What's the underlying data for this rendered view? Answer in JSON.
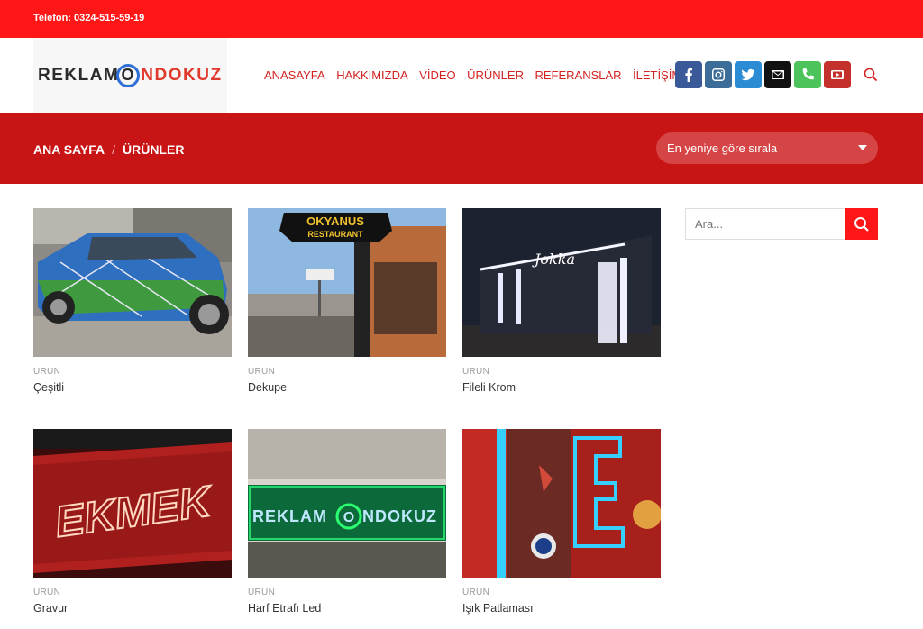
{
  "topbar": {
    "phone": "Telefon: 0324-515-59-19"
  },
  "header": {
    "logo": {
      "part1": "REKLAM",
      "ring": "O",
      "part2": "NDOKUZ"
    },
    "nav": [
      {
        "label": "ANASAYFA"
      },
      {
        "label": "HAKKIMIZDA"
      },
      {
        "label": "VİDEO"
      },
      {
        "label": "ÜRÜNLER"
      },
      {
        "label": "REFERANSLAR"
      },
      {
        "label": "İLETİŞİM"
      }
    ],
    "social": [
      {
        "icon": "facebook-icon",
        "color": "#3a5998"
      },
      {
        "icon": "instagram-icon",
        "color": "#3b6d98"
      },
      {
        "icon": "twitter-icon",
        "color": "#2b8bd4"
      },
      {
        "icon": "envelope-icon",
        "color": "#111111"
      },
      {
        "icon": "phone-icon",
        "color": "#4cc35b"
      },
      {
        "icon": "youtube-icon",
        "color": "#c4302b"
      }
    ]
  },
  "banner": {
    "breadcrumb": {
      "home": "ANA SAYFA",
      "separator": "/",
      "current": "ÜRÜNLER"
    },
    "sort": {
      "selected": "En yeniye göre sırala"
    }
  },
  "products": [
    {
      "category": "URUN",
      "name": "Çeşitli"
    },
    {
      "category": "URUN",
      "name": "Dekupe"
    },
    {
      "category": "URUN",
      "name": "Fileli Krom"
    },
    {
      "category": "URUN",
      "name": "Gravur"
    },
    {
      "category": "URUN",
      "name": "Harf Etrafı Led"
    },
    {
      "category": "URUN",
      "name": "Işık Patlaması"
    }
  ],
  "product_image_text": {
    "p2_sign_line1": "OKYANUS",
    "p2_sign_line2": "RESTAURANT",
    "p3_sign": "Jokka",
    "p4_sign": "EKMEK",
    "p5_sign_part1": "REKLAM",
    "p5_sign_ring": "O",
    "p5_sign_part2": "NDOKUZ"
  },
  "sidebar": {
    "search_placeholder": "Ara..."
  },
  "colors": {
    "primary": "#ff1616",
    "banner": "#c81414",
    "nav_text": "#d42222"
  }
}
